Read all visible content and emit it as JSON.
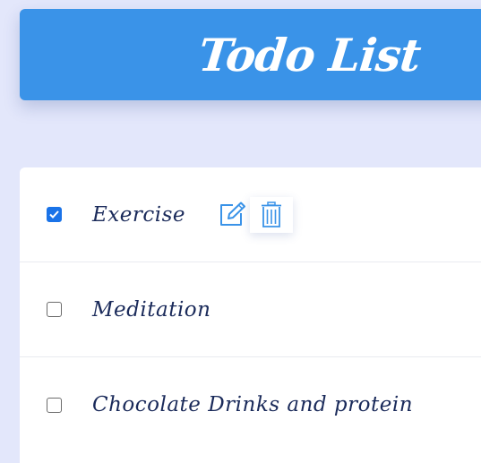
{
  "header": {
    "title": "Todo List"
  },
  "colors": {
    "accent": "#3a93e8",
    "background": "#e3e7fb",
    "text": "#1a2a5a"
  },
  "todos": [
    {
      "label": "Exercise",
      "checked": true,
      "actions": [
        "edit-icon",
        "trash-icon"
      ]
    },
    {
      "label": "Meditation",
      "checked": false
    },
    {
      "label": "Chocolate Drinks and protein",
      "checked": false
    }
  ]
}
